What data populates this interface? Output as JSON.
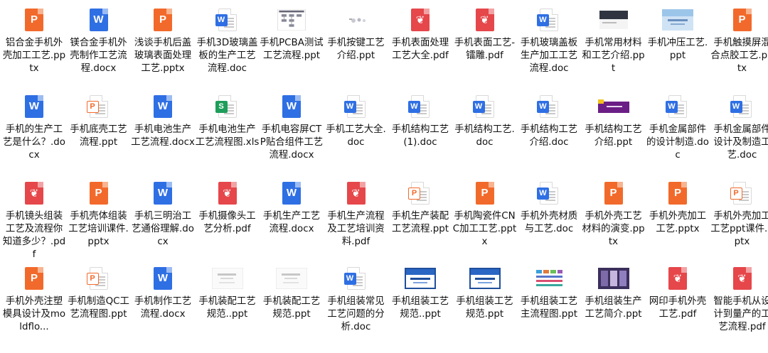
{
  "colors": {
    "word": "#2f6fe4",
    "ppt": "#f26a2b",
    "pdf": "#e5474b",
    "xls": "#1e9e5a"
  },
  "files": [
    {
      "name": "铝合金手机外壳加工工艺.pptx",
      "icon": "ppt-icon"
    },
    {
      "name": "镁合金手机外壳制作工艺流程.docx",
      "icon": "word-icon"
    },
    {
      "name": "浅谈手机后盖玻璃表面处理工艺.pptx",
      "icon": "ppt-icon"
    },
    {
      "name": "手机3D玻璃盖板的生产工艺流程.doc",
      "icon": "word-outline-icon"
    },
    {
      "name": "手机PCBA测试工艺流程.ppt",
      "icon": "flowchart-thumbnail-icon"
    },
    {
      "name": "手机按键工艺介绍.ppt",
      "icon": "keypad-thumbnail-icon"
    },
    {
      "name": "手机表面处理工艺大全.pdf",
      "icon": "pdf-icon"
    },
    {
      "name": "手机表面工艺-镭雕.pdf",
      "icon": "pdf-icon"
    },
    {
      "name": "手机玻璃盖板生产加工工艺流程.doc",
      "icon": "word-outline-icon"
    },
    {
      "name": "手机常用材料和工艺介绍.ppt",
      "icon": "dark-slide-thumbnail-icon"
    },
    {
      "name": "手机冲压工艺.ppt",
      "icon": "blue-slide-thumbnail-icon"
    },
    {
      "name": "手机触摸屏混合点胶工艺.pptx",
      "icon": "ppt-icon"
    },
    {
      "name": "手机的生产工艺是什么？.docx",
      "icon": "word-icon"
    },
    {
      "name": "手机底壳工艺流程.ppt",
      "icon": "ppt-outline-icon"
    },
    {
      "name": "手机电池生产工艺流程.docx",
      "icon": "word-icon"
    },
    {
      "name": "手机电池生产工艺流程图.xls",
      "icon": "xls-outline-icon"
    },
    {
      "name": "手机电容屏CTP贴合组件工艺流程.docx",
      "icon": "word-icon"
    },
    {
      "name": "手机工艺大全.doc",
      "icon": "word-outline-icon"
    },
    {
      "name": "手机结构工艺 (1).doc",
      "icon": "word-outline-icon"
    },
    {
      "name": "手机结构工艺.doc",
      "icon": "word-outline-icon"
    },
    {
      "name": "手机结构工艺介绍.doc",
      "icon": "word-outline-icon"
    },
    {
      "name": "手机结构工艺介绍.ppt",
      "icon": "purple-slide-thumbnail-icon"
    },
    {
      "name": "手机金属部件的设计制造.doc",
      "icon": "word-outline-icon"
    },
    {
      "name": "手机金属部件设计及制造工艺.doc",
      "icon": "word-outline-icon"
    },
    {
      "name": "手机镜头组装工艺及流程你知道多少？.pdf",
      "icon": "pdf-icon"
    },
    {
      "name": "手机壳体组装工艺培训课件.pptx",
      "icon": "ppt-icon"
    },
    {
      "name": "手机三明治工艺通俗理解.docx",
      "icon": "word-icon"
    },
    {
      "name": "手机摄像头工艺分析.pdf",
      "icon": "pdf-icon"
    },
    {
      "name": "手机生产工艺流程.docx",
      "icon": "word-icon"
    },
    {
      "name": "手机生产流程及工艺培训资料.pdf",
      "icon": "pdf-icon"
    },
    {
      "name": "手机生产装配工艺流程.ppt",
      "icon": "ppt-outline-icon"
    },
    {
      "name": "手机陶瓷件CNC加工工艺.pptx",
      "icon": "ppt-icon"
    },
    {
      "name": "手机外壳材质与工艺.doc",
      "icon": "word-outline-icon"
    },
    {
      "name": "手机外壳工艺材料的演变.pptx",
      "icon": "ppt-icon"
    },
    {
      "name": "手机外壳加工工艺.pptx",
      "icon": "ppt-icon"
    },
    {
      "name": "手机外壳加工工艺ppt课件.pptx",
      "icon": "ppt-outline-icon"
    },
    {
      "name": "手机外壳注塑模具设计及moldflo...",
      "icon": "ppt-icon"
    },
    {
      "name": "手机制造QC工艺流程图.ppt",
      "icon": "ppt-outline-icon"
    },
    {
      "name": "手机制作工艺流程.docx",
      "icon": "word-icon"
    },
    {
      "name": "手机装配工艺规范..ppt",
      "icon": "gray-slide-thumbnail-icon"
    },
    {
      "name": "手机装配工艺规范.ppt",
      "icon": "gray-slide-thumbnail-icon"
    },
    {
      "name": "手机组装常见工艺问题的分析.doc",
      "icon": "word-outline-icon"
    },
    {
      "name": "手机组装工艺规范..ppt",
      "icon": "blue-title-thumbnail-icon"
    },
    {
      "name": "手机组装工艺规范.ppt",
      "icon": "blue-title-thumbnail-icon"
    },
    {
      "name": "手机组装工艺主流程图.ppt",
      "icon": "color-chart-thumbnail-icon"
    },
    {
      "name": "手机组装生产工艺简介.ppt",
      "icon": "photo-slide-thumbnail-icon"
    },
    {
      "name": "网印手机外壳工艺.pdf",
      "icon": "pdf-icon"
    },
    {
      "name": "智能手机从设计到量产的工艺流程.pdf",
      "icon": "pdf-icon"
    }
  ]
}
